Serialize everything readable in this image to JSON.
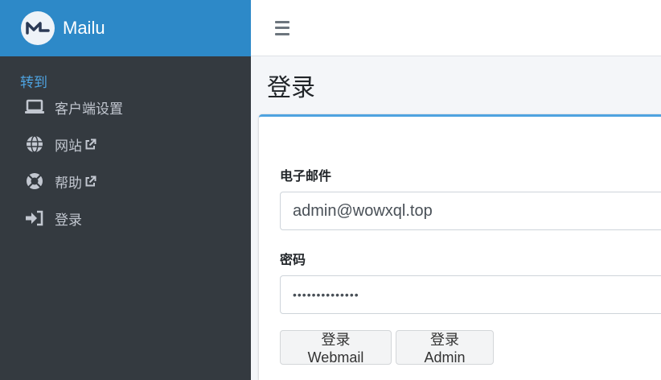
{
  "brand": {
    "name": "Mailu",
    "logo_icon": "mailu-logo-icon"
  },
  "sidebar": {
    "header": "转到",
    "items": [
      {
        "label": "客户端设置",
        "icon": "laptop-icon",
        "external": false
      },
      {
        "label": "网站",
        "icon": "globe-icon",
        "external": true
      },
      {
        "label": "帮助",
        "icon": "lifebuoy-icon",
        "external": true
      },
      {
        "label": "登录",
        "icon": "sign-in-icon",
        "external": false
      }
    ]
  },
  "navbar": {
    "menu_icon": "hamburger-menu-icon"
  },
  "page": {
    "title": "登录"
  },
  "form": {
    "email_label": "电子邮件",
    "email_value": "admin@wowxql.top",
    "password_label": "密码",
    "password_value": "••••••••••••••",
    "login_webmail": "登录 Webmail",
    "login_admin": "登录 Admin"
  },
  "colors": {
    "brand": "#2d89c8",
    "sidebar_bg": "#343a40",
    "sidebar_text": "#c2c7d0",
    "nav_header": "#4ea3e0",
    "card_accent": "#4ea3e0"
  }
}
